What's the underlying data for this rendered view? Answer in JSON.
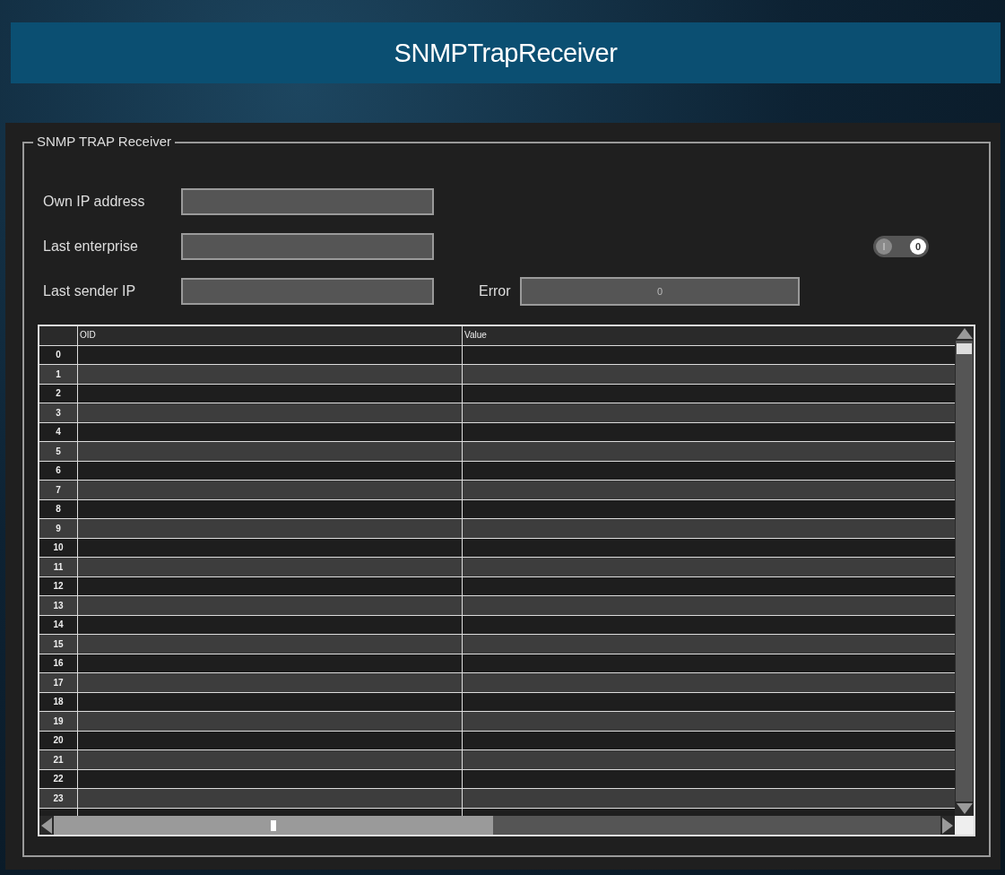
{
  "window": {
    "title": "SNMPTrapReceiver"
  },
  "group": {
    "title": "SNMP TRAP Receiver"
  },
  "fields": [
    {
      "label": "Own IP address"
    },
    {
      "label": "Last enterprise"
    },
    {
      "label": "Last sender IP"
    }
  ],
  "error": {
    "label": "Error",
    "value": "0"
  },
  "toggle": {
    "on_label": "I",
    "off_label": "0",
    "on": false
  },
  "table": {
    "columns": [
      "OID",
      "Value"
    ],
    "rows": [
      "0",
      "1",
      "2",
      "3",
      "4",
      "5",
      "6",
      "7",
      "8",
      "9",
      "10",
      "11",
      "12",
      "13",
      "14",
      "15",
      "16",
      "17",
      "18",
      "19",
      "20",
      "21",
      "22",
      "23"
    ]
  }
}
